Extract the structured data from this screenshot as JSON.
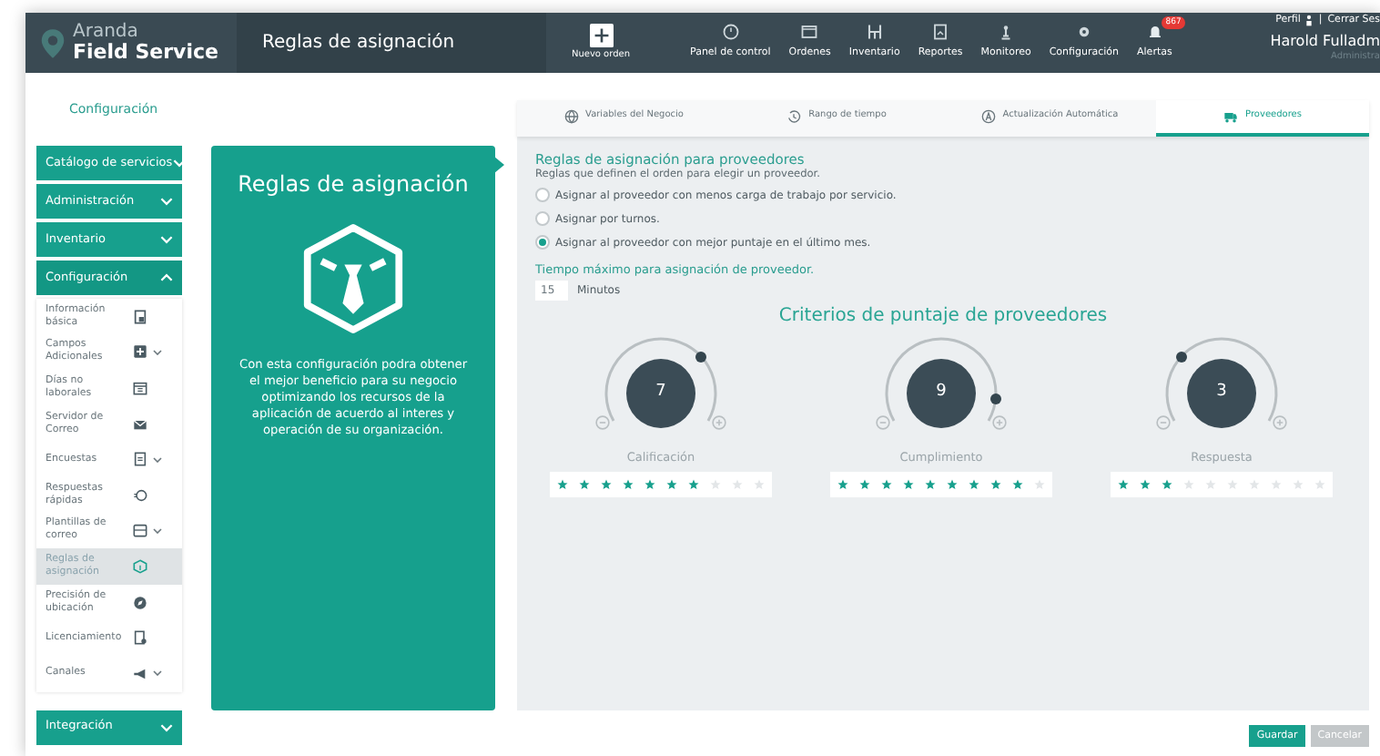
{
  "header": {
    "logo": {
      "line1": "Aranda",
      "line2": "Field Service"
    },
    "page_title": "Reglas de asignación",
    "new_order": "Nuevo orden",
    "nav": [
      {
        "label": "Panel de control"
      },
      {
        "label": "Ordenes"
      },
      {
        "label": "Inventario"
      },
      {
        "label": "Reportes"
      },
      {
        "label": "Monitoreo"
      },
      {
        "label": "Configuración"
      },
      {
        "label": "Alertas",
        "badge": "867"
      }
    ],
    "profile": {
      "profile_link": "Perfil",
      "separator": "|",
      "logout": "Cerrar Ses",
      "user_name": "Harold Fulladm",
      "role": "Administra"
    }
  },
  "breadcrumb": "Configuración",
  "sidebar": {
    "groups": [
      {
        "label": "Catálogo de servicios",
        "expanded": false
      },
      {
        "label": "Administración",
        "expanded": false
      },
      {
        "label": "Inventario",
        "expanded": false
      },
      {
        "label": "Configuración",
        "expanded": true,
        "items": [
          {
            "label": "Información básica",
            "expandable": false,
            "selected": false
          },
          {
            "label": "Campos Adicionales",
            "expandable": true,
            "selected": false
          },
          {
            "label": "Días no laborales",
            "expandable": false,
            "selected": false
          },
          {
            "label": "Servidor de Correo",
            "expandable": false,
            "selected": false
          },
          {
            "label": "Encuestas",
            "expandable": true,
            "selected": false
          },
          {
            "label": "Respuestas rápidas",
            "expandable": false,
            "selected": false
          },
          {
            "label": "Plantillas de correo",
            "expandable": true,
            "selected": false
          },
          {
            "label": "Reglas de asignación",
            "expandable": false,
            "selected": true
          },
          {
            "label": "Precisión de ubicación",
            "expandable": false,
            "selected": false
          },
          {
            "label": "Licenciamiento",
            "expandable": false,
            "selected": false
          },
          {
            "label": "Canales",
            "expandable": true,
            "selected": false
          }
        ]
      },
      {
        "label": "Integración",
        "expanded": false
      }
    ]
  },
  "info_panel": {
    "title": "Reglas de asignación",
    "description": "Con esta configuración podra obtener el mejor beneficio para su negocio optimizando los recursos de la aplicación de acuerdo al interes y operación de su organización."
  },
  "tabs": [
    {
      "label": "Variables del Negocio",
      "selected": false
    },
    {
      "label": "Rango de tiempo",
      "selected": false
    },
    {
      "label": "Actualización Automática",
      "selected": false
    },
    {
      "label": "Proveedores",
      "selected": true
    }
  ],
  "rules": {
    "title": "Reglas de asignación para proveedores",
    "subtitle": "Reglas que definen el orden para elegir un proveedor.",
    "options": [
      {
        "label": "Asignar al proveedor con menos carga de trabajo por servicio.",
        "selected": false
      },
      {
        "label": "Asignar por turnos.",
        "selected": false
      },
      {
        "label": "Asignar al proveedor con mejor puntaje en el último mes.",
        "selected": true
      }
    ]
  },
  "max_time": {
    "label": "Tiempo máximo para asignación de proveedor.",
    "value": "15",
    "unit": "Minutos"
  },
  "criteria": {
    "title": "Criterios de puntaje de proveedores",
    "dials": [
      {
        "value": "7",
        "label": "Calificación",
        "stars": 7
      },
      {
        "value": "9",
        "label": "Cumplimiento",
        "stars": 9
      },
      {
        "value": "3",
        "label": "Respuesta",
        "stars": 3
      }
    ]
  },
  "buttons": [
    {
      "label": "Guardar",
      "kind": "primary"
    },
    {
      "label": "Cancelar",
      "kind": "secondary"
    }
  ]
}
